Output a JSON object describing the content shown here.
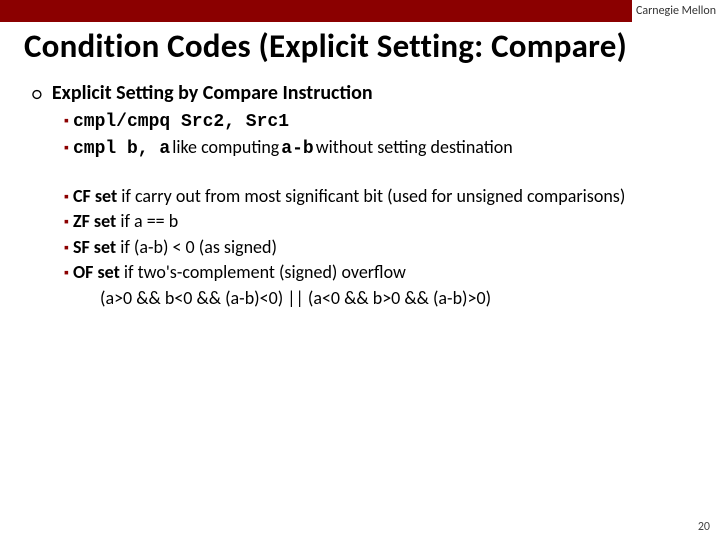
{
  "brand": "Carnegie Mellon",
  "title": "Condition Codes (Explicit Setting: Compare)",
  "heading": "Explicit Setting by Compare Instruction",
  "b1": {
    "code": "cmpl/cmpq Src2, Src1"
  },
  "b2": {
    "code": "cmpl b, a",
    "rest": " like computing ",
    "code2": "a-b",
    "rest2": " without setting destination"
  },
  "cf": {
    "lead": "CF set",
    "rest": " if carry out from most significant bit (used for unsigned comparisons)"
  },
  "zf": {
    "lead": "ZF set",
    "rest": " if a == b"
  },
  "sf": {
    "lead": "SF set",
    "rest": " if (a-b) < 0 (as signed)"
  },
  "of": {
    "lead": "OF set",
    "rest": " if two's-complement (signed) overflow"
  },
  "of_extra": "(a>0 && b<0 && (a-b)<0) || (a<0 && b>0 && (a-b)>0)",
  "page": "20"
}
